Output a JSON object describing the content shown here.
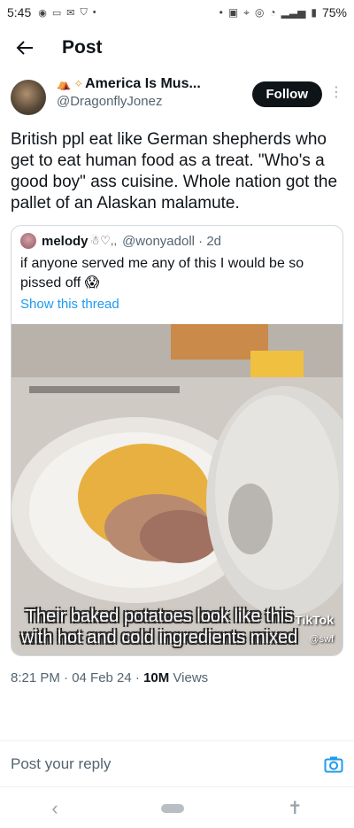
{
  "status_bar": {
    "time": "5:45",
    "battery": "75%"
  },
  "nav": {
    "title": "Post"
  },
  "tweet": {
    "author_name": "America Is Mus...",
    "author_handle": "@DragonflyJonez",
    "follow_label": "Follow",
    "text": "British ppl eat like German shepherds who get to eat human food as a treat. \"Who's a good boy\" ass cuisine. Whole nation got the pallet of an Alaskan malamute.",
    "quote": {
      "name": "melody",
      "name_emoji": "☃♡,,",
      "handle_time": "@wonyadoll · 2d",
      "text": "if anyone served me any of this I would be so pissed off 😱",
      "show_thread": "Show this thread",
      "media_caption": "Their baked potatoes look like this with hot and cold ingredients mixed",
      "tiktok_label": "TikTok",
      "tiktok_user": "@swf"
    },
    "time_date": "8:21 PM · 04 Feb 24 · ",
    "views_count": "10M",
    "views_label": " Views"
  },
  "reply": {
    "placeholder": "Post your reply"
  }
}
